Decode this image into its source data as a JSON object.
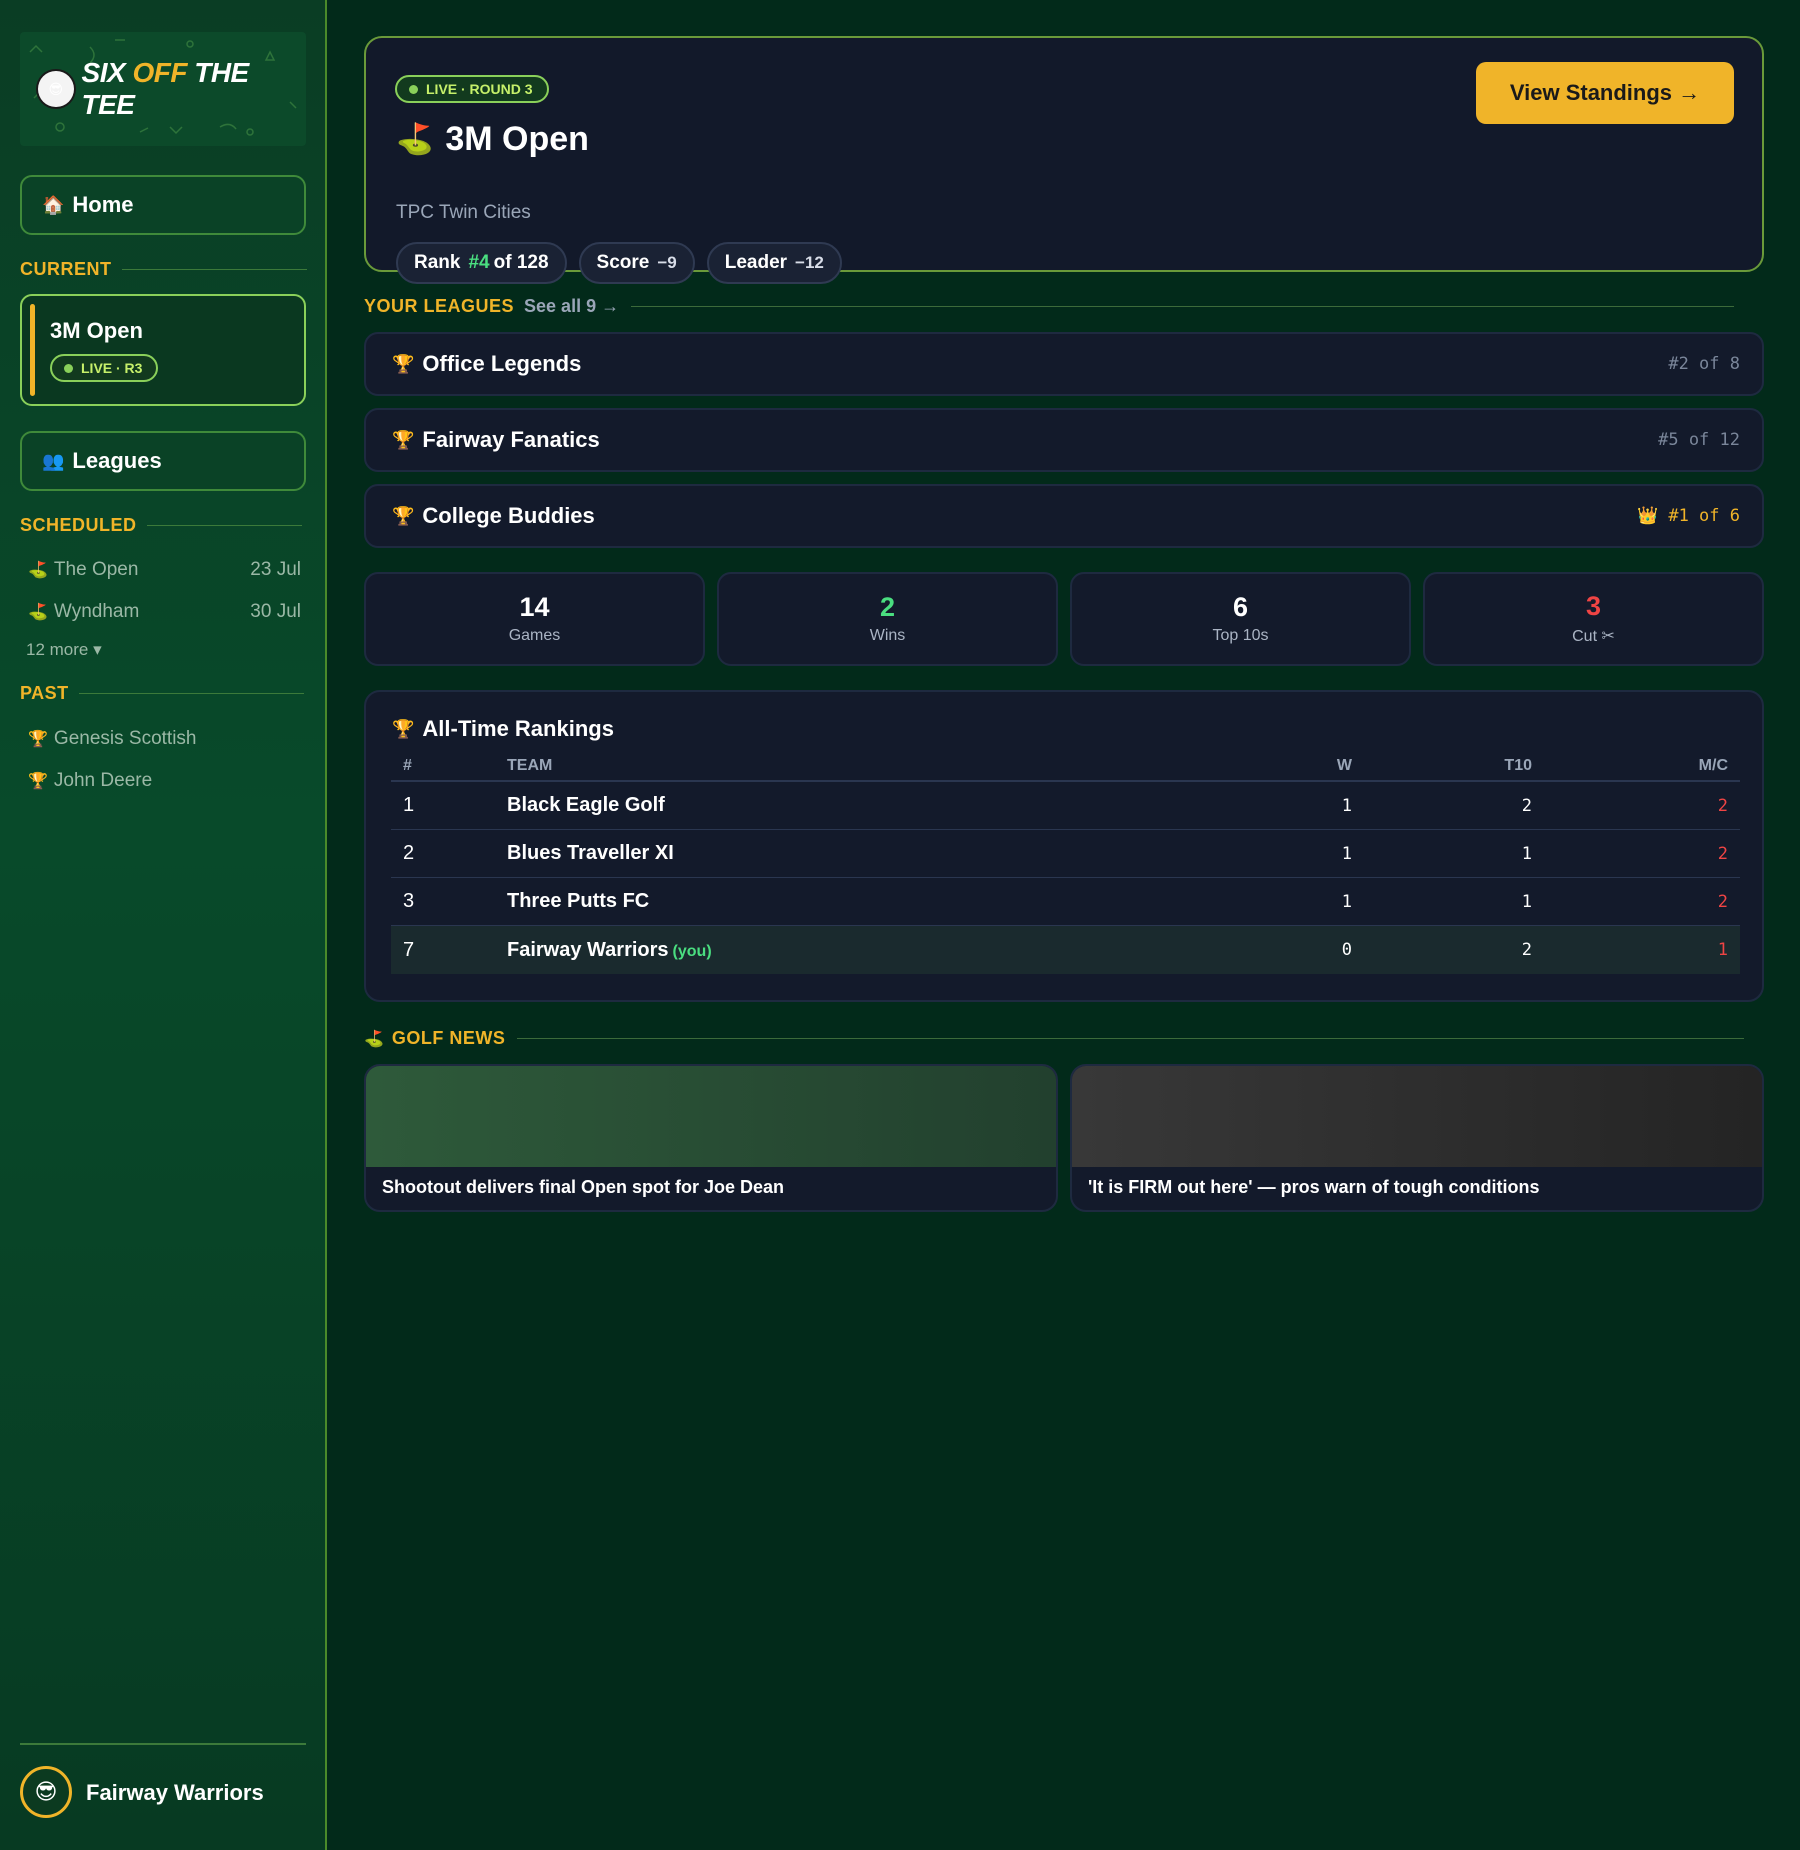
{
  "brand": {
    "word1": "SIX",
    "word2": "OFF",
    "word3": "THE TEE"
  },
  "sidebar": {
    "home_label": "Home",
    "current_label": "CURRENT",
    "current_event": {
      "name": "3M Open",
      "status": "LIVE · R3"
    },
    "leagues_label": "Leagues",
    "scheduled_label": "SCHEDULED",
    "scheduled": [
      {
        "name": "The Open",
        "date": "23 Jul"
      },
      {
        "name": "Wyndham",
        "date": "30 Jul"
      }
    ],
    "more_label": "12 more ▾",
    "past_label": "PAST",
    "past": [
      {
        "name": "Genesis Scottish"
      },
      {
        "name": "John Deere"
      }
    ],
    "user_name": "Fairway Warriors"
  },
  "hero": {
    "status": "LIVE · ROUND 3",
    "title": "3M Open",
    "venue": "TPC Twin Cities",
    "rank_label": "Rank",
    "rank_value": "#4",
    "rank_suffix": "of 128",
    "score_label": "Score",
    "score_value": "−9",
    "leader_label": "Leader",
    "leader_value": "−12",
    "cta": "View Standings →"
  },
  "leagues": {
    "title": "YOUR LEAGUES",
    "see_all": "See all 9 →",
    "items": [
      {
        "name": "Office Legends",
        "rank": "#2 of 8"
      },
      {
        "name": "Fairway Fanatics",
        "rank": "#5 of 12"
      },
      {
        "name": "College Buddies",
        "rank": "#1 of 6"
      }
    ]
  },
  "stats": [
    {
      "value": "14",
      "label": "Games",
      "color": "#ffffff"
    },
    {
      "value": "2",
      "label": "Wins",
      "color": "#4ade80"
    },
    {
      "value": "6",
      "label": "Top 10s",
      "color": "#ffffff"
    },
    {
      "value": "3",
      "label": "Cut ✂",
      "color": "#ef4444"
    }
  ],
  "rankings": {
    "title": "All-Time Rankings",
    "headers": {
      "num": "#",
      "team": "TEAM",
      "w": "W",
      "t10": "T10",
      "mc": "M/C"
    },
    "rows": [
      {
        "num": "1",
        "team": "Black Eagle Golf",
        "w": "1",
        "t10": "2",
        "mc": "2"
      },
      {
        "num": "2",
        "team": "Blues Traveller XI",
        "w": "1",
        "t10": "1",
        "mc": "2"
      },
      {
        "num": "3",
        "team": "Three Putts FC",
        "w": "1",
        "t10": "1",
        "mc": "2"
      },
      {
        "num": "7",
        "team": "Fairway Warriors",
        "you": "(you)",
        "w": "0",
        "t10": "2",
        "mc": "1"
      }
    ]
  },
  "news": {
    "title": "GOLF NEWS",
    "items": [
      {
        "headline": "Shootout delivers final Open spot for Joe Dean"
      },
      {
        "headline": "'It is FIRM out here' — pros warn of tough conditions"
      }
    ]
  },
  "colors": {
    "accent": "#f0b429",
    "live": "#8ad05a",
    "positive": "#4ade80",
    "negative": "#ef4444",
    "background": "#022a1a",
    "card": "#131a2b"
  }
}
